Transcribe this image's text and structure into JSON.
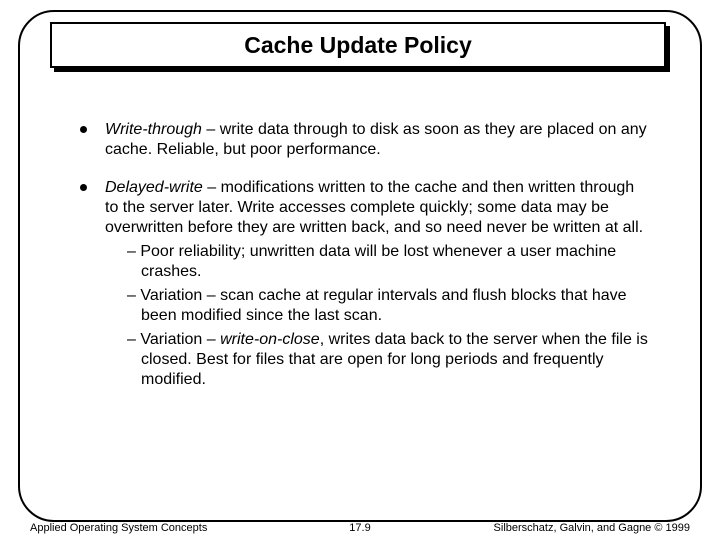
{
  "title": "Cache Update Policy",
  "bullets": [
    {
      "term": "Write-through",
      "rest": " – write data through to disk as soon as they are placed on any cache.  Reliable, but poor performance."
    },
    {
      "term": "Delayed-write",
      "rest": " – modifications written to the cache and then written through to the server later.  Write accesses complete quickly; some data may be overwritten before they are written back, and so need never be written at all.",
      "subs": [
        "Poor reliability; unwritten data will be lost whenever a user machine crashes.",
        "Variation – scan cache at regular intervals and flush blocks that have been modified since the last scan.",
        {
          "pre": "Variation – ",
          "term": "write-on-close",
          "post": ", writes data back to the server when the file is closed.  Best for files that are open for long periods and frequently modified."
        }
      ]
    }
  ],
  "footer": {
    "left": "Applied Operating System Concepts",
    "center": "17.9",
    "right": "Silberschatz, Galvin, and Gagne © 1999"
  }
}
